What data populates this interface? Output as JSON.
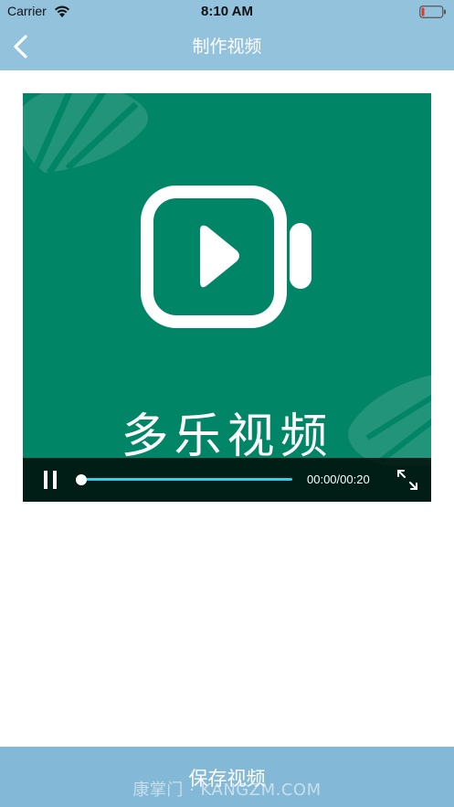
{
  "status_bar": {
    "carrier": "Carrier",
    "time": "8:10 AM",
    "wifi_icon": "wifi-icon",
    "battery_icon": "battery-low-icon"
  },
  "nav": {
    "title": "制作视频",
    "back_icon": "chevron-left-icon"
  },
  "video": {
    "overlay_title": "多乐视频",
    "current_time": "00:00",
    "duration": "00:20",
    "time_display": "00:00/00:20",
    "progress": 0,
    "state_icon": "pause-icon",
    "fullscreen_icon": "fullscreen-icon",
    "background_color": "#008566"
  },
  "footer": {
    "save_label": "保存视频",
    "watermark": "康掌门 · KANGZM.COM"
  },
  "colors": {
    "header": "#93c2dd",
    "save_bar": "#83b8d6",
    "progress": "#2fd3dd"
  }
}
